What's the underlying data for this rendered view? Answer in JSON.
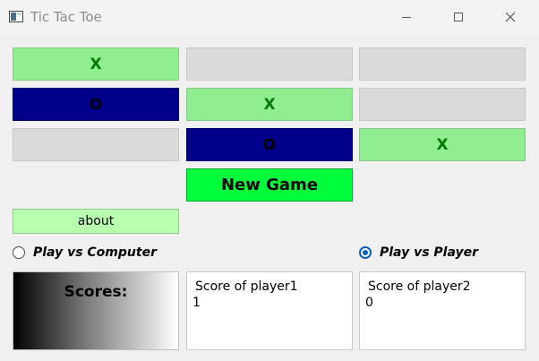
{
  "window": {
    "title": "Tic Tac Toe",
    "icon": "app-window-icon",
    "controls": [
      "minimize-icon",
      "maximize-icon",
      "close-icon"
    ]
  },
  "board": {
    "cells": [
      [
        "X",
        "",
        ""
      ],
      [
        "O",
        "X",
        ""
      ],
      [
        "",
        "O",
        "X"
      ]
    ],
    "colors": {
      "x_bg": "#90ee90",
      "x_text": "#007a00",
      "o_bg": "#00008b",
      "empty_bg": "#dadada"
    }
  },
  "controls": {
    "new_game_label": "New Game",
    "new_game_color": "#00ff3a",
    "about_label": "about",
    "about_color": "#b8ffb0"
  },
  "mode": {
    "vs_computer_label": "Play vs Computer",
    "vs_player_label": "Play vs Player",
    "selected": "Play vs Player"
  },
  "scores": {
    "title": "Scores:",
    "player1_label": "Score of player1",
    "player1_value": "1",
    "player2_label": "Score of player2",
    "player2_value": "0"
  }
}
